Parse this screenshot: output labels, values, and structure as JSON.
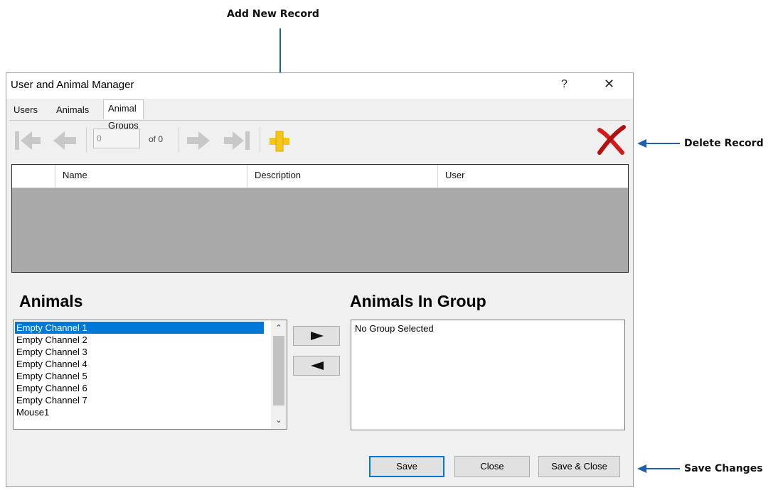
{
  "callouts": {
    "add_record": "Add New Record",
    "delete_record": "Delete Record",
    "save_changes": "Save Changes"
  },
  "window": {
    "title": "User and Animal Manager",
    "help_glyph": "?",
    "close_glyph": "✕"
  },
  "tabs": [
    {
      "label": "Users"
    },
    {
      "label": "Animals"
    },
    {
      "label": "Animal Groups",
      "active": true
    }
  ],
  "toolbar": {
    "position_value": "0",
    "of_label": "of 0",
    "icons": [
      "first-record-icon",
      "prev-record-icon",
      "next-record-icon",
      "last-record-icon",
      "add-record-icon",
      "delete-record-icon"
    ]
  },
  "grid": {
    "columns": [
      "Name",
      "Description",
      "User"
    ],
    "rows": []
  },
  "animals": {
    "title": "Animals",
    "items": [
      "Empty Channel 1",
      "Empty Channel 2",
      "Empty Channel 3",
      "Empty Channel 4",
      "Empty Channel 5",
      "Empty Channel 6",
      "Empty Channel 7",
      "Mouse1"
    ],
    "selected": "Empty Channel 1"
  },
  "group": {
    "title": "Animals In Group",
    "placeholder": "No Group Selected"
  },
  "buttons": {
    "save": "Save",
    "close": "Close",
    "save_close": "Save & Close"
  },
  "colors": {
    "accent": "#0078d7",
    "add_icon": "#f5c518",
    "delete_icon": "#d21c1c",
    "annotation_arrow": "#1f5fb0"
  }
}
